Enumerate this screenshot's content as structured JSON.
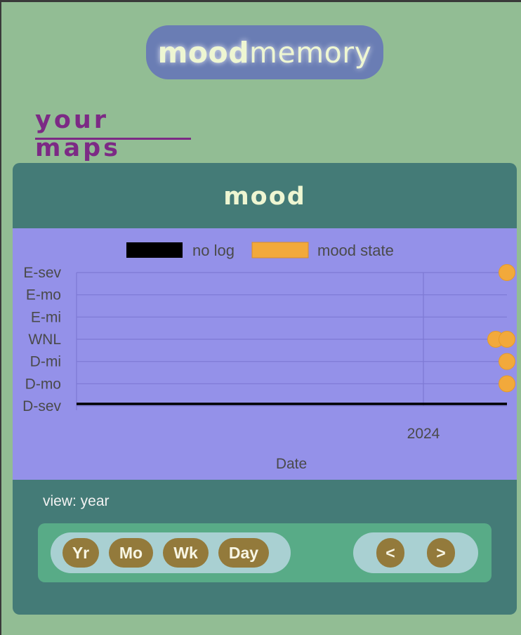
{
  "logo": {
    "bold": "mood",
    "light": "memory"
  },
  "page_heading": "your maps",
  "card": {
    "title": "mood"
  },
  "chart_data": {
    "type": "scatter",
    "title": "",
    "xlabel": "Date",
    "ylabel": "",
    "y_categories": [
      "D-sev",
      "D-mo",
      "D-mi",
      "WNL",
      "E-mi",
      "E-mo",
      "E-sev"
    ],
    "x_ticks": [
      "2024"
    ],
    "grid": true,
    "legend_position": "top",
    "series": [
      {
        "name": "no log",
        "color": "#000000",
        "kind": "line",
        "level": "D-sev",
        "x_range": [
          "2023-01",
          "2024-05"
        ]
      },
      {
        "name": "mood state",
        "color": "#f2a93b",
        "kind": "points",
        "points": [
          {
            "x": "2024-05",
            "y": "E-sev"
          },
          {
            "x": "2024-05",
            "y": "WNL"
          },
          {
            "x": "2024-05",
            "y": "WNL"
          },
          {
            "x": "2024-05",
            "y": "D-mi"
          },
          {
            "x": "2024-05",
            "y": "D-mo"
          }
        ]
      }
    ]
  },
  "view": {
    "label": "view: year"
  },
  "controls": {
    "range_buttons": [
      {
        "label": "Yr"
      },
      {
        "label": "Mo"
      },
      {
        "label": "Wk"
      },
      {
        "label": "Day"
      }
    ],
    "prev_label": "<",
    "next_label": ">"
  }
}
